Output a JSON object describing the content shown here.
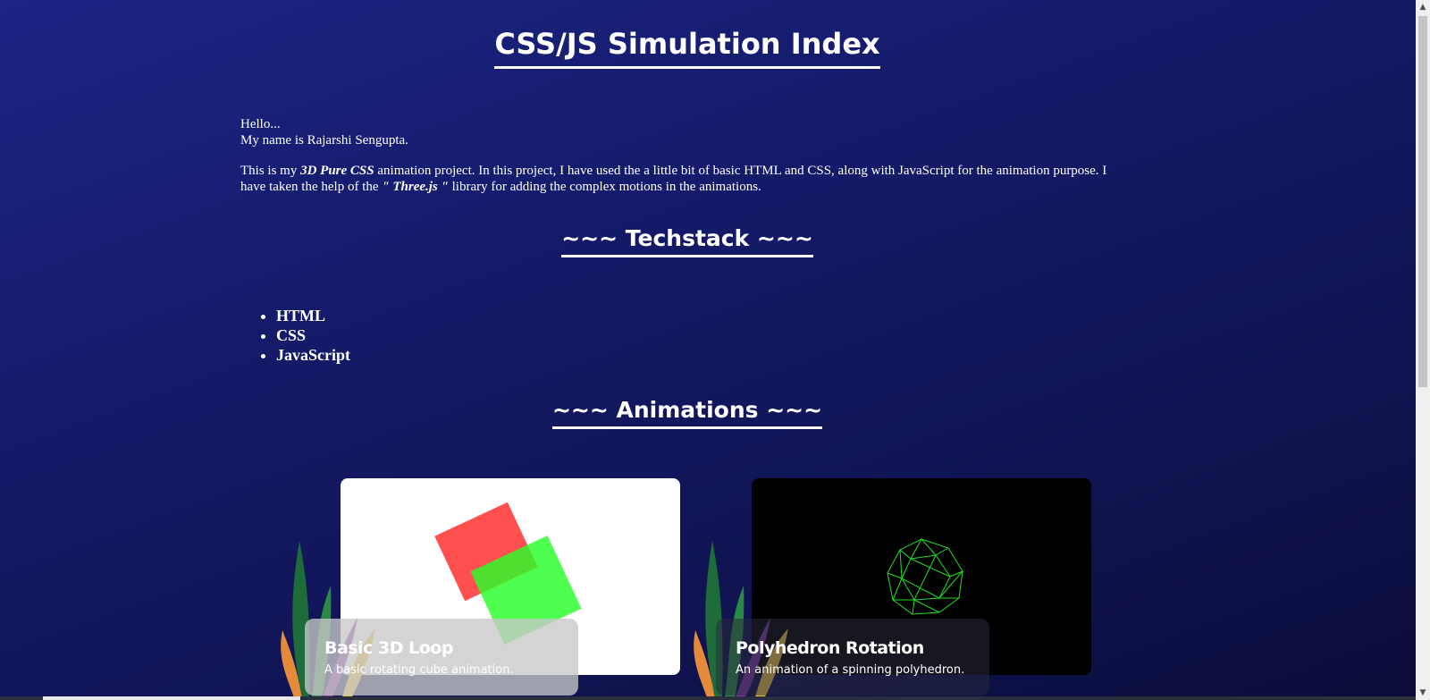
{
  "header": {
    "title": "CSS/JS Simulation Index"
  },
  "intro": {
    "greeting": "Hello...",
    "name_line": "My name is Rajarshi Sengupta.",
    "p_before_bold": "This is my ",
    "p_bold": "3D Pure CSS",
    "p_after_bold": " animation project. In this project, I have used the a little bit of basic HTML and CSS, along with JavaScript for the animation purpose. I have taken the help of the ",
    "p_lib": "\" Three.js \"",
    "p_end": " library for adding the complex motions in the animations."
  },
  "techstack": {
    "title": "~~~ Techstack ~~~",
    "items": [
      "HTML",
      "CSS",
      "JavaScript"
    ]
  },
  "animations": {
    "title": "~~~ Animations ~~~",
    "cards": [
      {
        "title": "Basic 3D Loop",
        "description": "A basic rotating cube animation."
      },
      {
        "title": "Polyhedron Rotation",
        "description": "An animation of a spinning polyhedron."
      }
    ]
  },
  "colors": {
    "background": "#151b6a",
    "red_square": "#ff2828",
    "green_square": "#28ff28",
    "wireframe": "#22dd22"
  },
  "icons": {
    "scroll_up": "triangle-up-icon",
    "scroll_down": "triangle-down-icon"
  }
}
